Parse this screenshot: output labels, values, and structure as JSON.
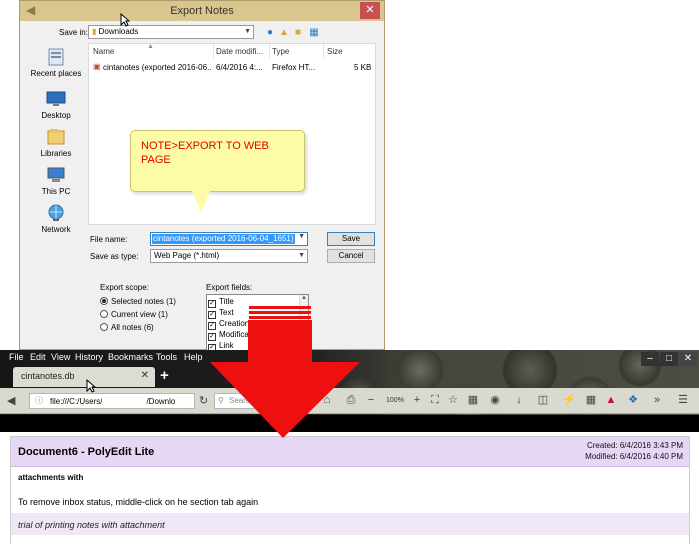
{
  "dialog": {
    "title": "Export Notes",
    "save_in_label": "Save in:",
    "save_in_value": "Downloads",
    "places": [
      {
        "label": "Recent places",
        "icon": "recent-places-icon"
      },
      {
        "label": "Desktop",
        "icon": "desktop-icon"
      },
      {
        "label": "Libraries",
        "icon": "libraries-icon"
      },
      {
        "label": "This PC",
        "icon": "this-pc-icon"
      },
      {
        "label": "Network",
        "icon": "network-icon"
      }
    ],
    "columns": [
      "Name",
      "Date modifi...",
      "Type",
      "Size"
    ],
    "files": [
      {
        "name": "cintanotes (exported 2016-06...",
        "date": "6/4/2016 4:...",
        "type": "Firefox HT...",
        "size": "5 KB"
      }
    ],
    "callout": "NOTE>EXPORT TO WEB PAGE",
    "file_name_label": "File name:",
    "file_name_value": "cintanotes (exported 2016-06-04_1651)",
    "save_as_label": "Save as type:",
    "save_as_value": "Web Page (*.html)",
    "save_button": "Save",
    "cancel_button": "Cancel",
    "export_scope_label": "Export scope:",
    "scope_options": [
      {
        "label": "Selected notes (1)",
        "checked": true
      },
      {
        "label": "Current view (1)",
        "checked": false
      },
      {
        "label": "All notes (6)",
        "checked": false
      }
    ],
    "export_fields_label": "Export fields:",
    "fields": [
      {
        "label": "Title",
        "checked": true
      },
      {
        "label": "Text",
        "checked": true
      },
      {
        "label": "Creation D",
        "checked": true
      },
      {
        "label": "Modificatio",
        "checked": true
      },
      {
        "label": "Link",
        "checked": true
      }
    ]
  },
  "browser": {
    "menu": [
      "File",
      "Edit",
      "View",
      "History",
      "Bookmarks",
      "Tools",
      "Help"
    ],
    "tab_title": "cintanotes.db",
    "url_prefix": "file:///C:/Users/",
    "url_suffix": "/Downlo",
    "search_placeholder": "Search",
    "zoom": "100%"
  },
  "note": {
    "title": "Document6 - PolyEdit Lite",
    "created": "Created: 6/4/2016 3:43 PM",
    "modified": "Modified: 6/4/2016 4:40 PM",
    "subtitle": "attachments with",
    "body": "To remove inbox status, middle-click on he section tab again",
    "footer": "trial of printing notes with attachment"
  },
  "colors": {
    "accent_red": "#ee1010",
    "callout_fill": "#fdfca6",
    "note_header": "#e6d7f5"
  }
}
